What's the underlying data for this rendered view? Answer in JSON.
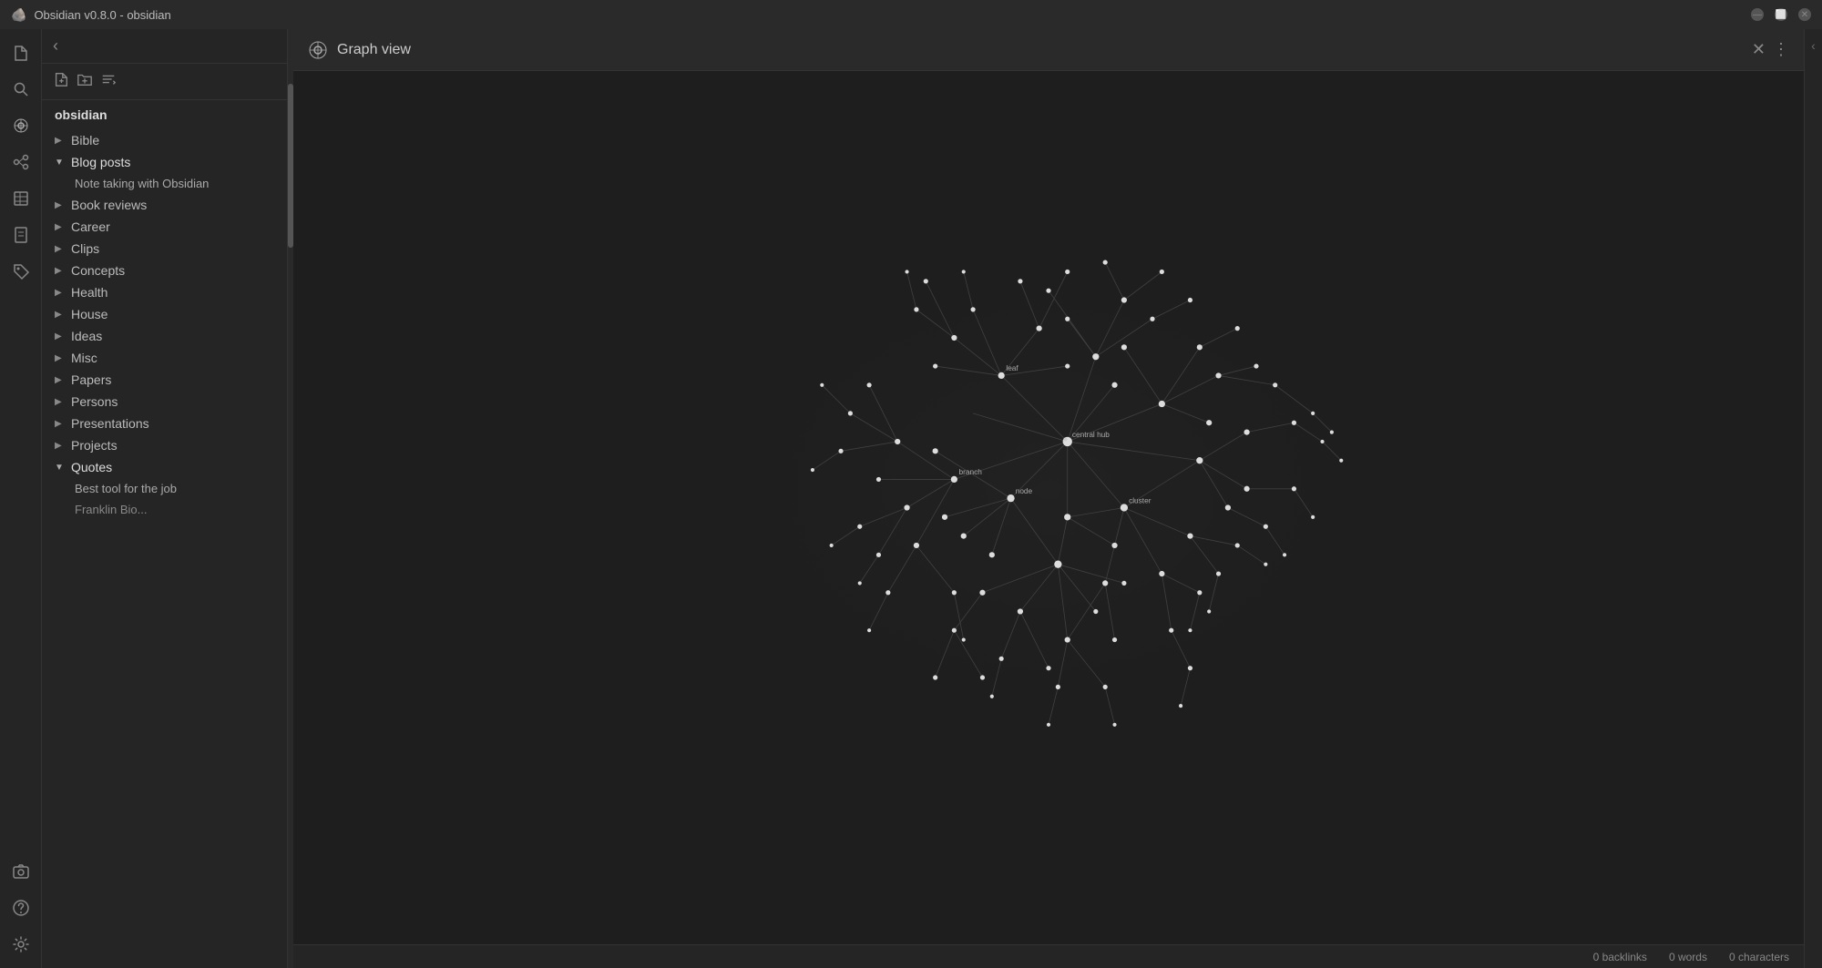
{
  "titlebar": {
    "title": "Obsidian v0.8.0 - obsidian",
    "icon": "🪨"
  },
  "sidebar": {
    "vault_name": "obsidian",
    "tree_items": [
      {
        "id": "bible",
        "label": "Bible",
        "expanded": false,
        "indent": 0
      },
      {
        "id": "blog-posts",
        "label": "Blog posts",
        "expanded": true,
        "indent": 0
      },
      {
        "id": "note-taking",
        "label": "Note taking with Obsidian",
        "expanded": false,
        "indent": 1,
        "is_child": true
      },
      {
        "id": "book-reviews",
        "label": "Book reviews",
        "expanded": false,
        "indent": 0
      },
      {
        "id": "career",
        "label": "Career",
        "expanded": false,
        "indent": 0
      },
      {
        "id": "clips",
        "label": "Clips",
        "expanded": false,
        "indent": 0
      },
      {
        "id": "concepts",
        "label": "Concepts",
        "expanded": false,
        "indent": 0
      },
      {
        "id": "health",
        "label": "Health",
        "expanded": false,
        "indent": 0
      },
      {
        "id": "house",
        "label": "House",
        "expanded": false,
        "indent": 0
      },
      {
        "id": "ideas",
        "label": "Ideas",
        "expanded": false,
        "indent": 0
      },
      {
        "id": "misc",
        "label": "Misc",
        "expanded": false,
        "indent": 0
      },
      {
        "id": "papers",
        "label": "Papers",
        "expanded": false,
        "indent": 0
      },
      {
        "id": "persons",
        "label": "Persons",
        "expanded": false,
        "indent": 0
      },
      {
        "id": "presentations",
        "label": "Presentations",
        "expanded": false,
        "indent": 0
      },
      {
        "id": "projects",
        "label": "Projects",
        "expanded": false,
        "indent": 0
      },
      {
        "id": "quotes",
        "label": "Quotes",
        "expanded": true,
        "indent": 0
      },
      {
        "id": "best-tool",
        "label": "Best tool for the job",
        "expanded": false,
        "indent": 1,
        "is_child": true
      }
    ]
  },
  "graph": {
    "title": "Graph view",
    "nodes_count": 150
  },
  "status_bar": {
    "backlinks": "0 backlinks",
    "words": "0 words",
    "characters": "0 characters"
  },
  "activity_bar": {
    "items": [
      {
        "id": "files",
        "icon": "📁"
      },
      {
        "id": "search",
        "icon": "🔍"
      },
      {
        "id": "graph",
        "icon": "◎"
      },
      {
        "id": "backlinks",
        "icon": "⚙"
      },
      {
        "id": "tables",
        "icon": "▦"
      },
      {
        "id": "bookmarks",
        "icon": "📋"
      },
      {
        "id": "tags",
        "icon": "🏷"
      },
      {
        "id": "camera",
        "icon": "📷"
      },
      {
        "id": "help",
        "icon": "❓"
      },
      {
        "id": "settings",
        "icon": "⚙"
      }
    ]
  }
}
